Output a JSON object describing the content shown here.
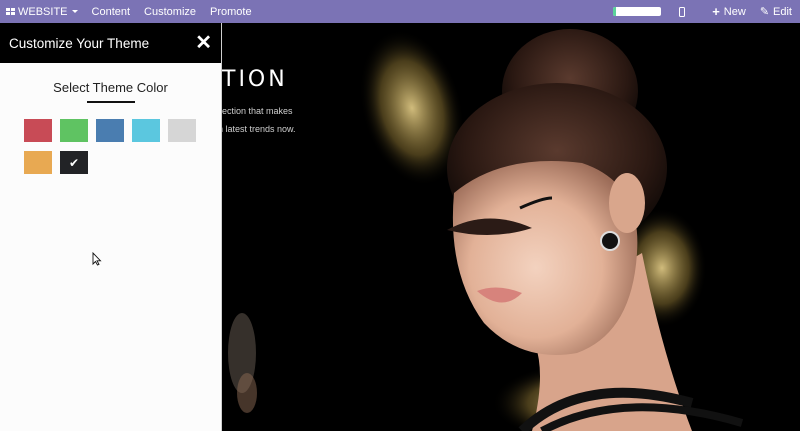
{
  "topbar": {
    "website_label": "WEBSITE",
    "content_label": "Content",
    "customize_label": "Customize",
    "promote_label": "Promote",
    "new_label": "New",
    "edit_label": "Edit",
    "progress_fraction": 0.06
  },
  "panel": {
    "title": "Customize Your Theme",
    "section_title": "Select Theme Color",
    "swatches": [
      {
        "name": "red",
        "color": "#c84b56"
      },
      {
        "name": "green",
        "color": "#5fc362"
      },
      {
        "name": "blue",
        "color": "#4a7db0"
      },
      {
        "name": "cyan",
        "color": "#5bc7df"
      },
      {
        "name": "light-gray",
        "color": "#d6d6d6"
      },
      {
        "name": "orange",
        "color": "#e8a952"
      },
      {
        "name": "black",
        "color": "#222326",
        "selected": true
      }
    ],
    "selected_check": "✔"
  },
  "hero": {
    "title": "TION",
    "line1": "llection that makes",
    "line2": "h latest trends now."
  },
  "colors": {
    "topbar": "#7b73b5",
    "panel_header": "#000000",
    "accent_progress": "#5ad39a"
  }
}
